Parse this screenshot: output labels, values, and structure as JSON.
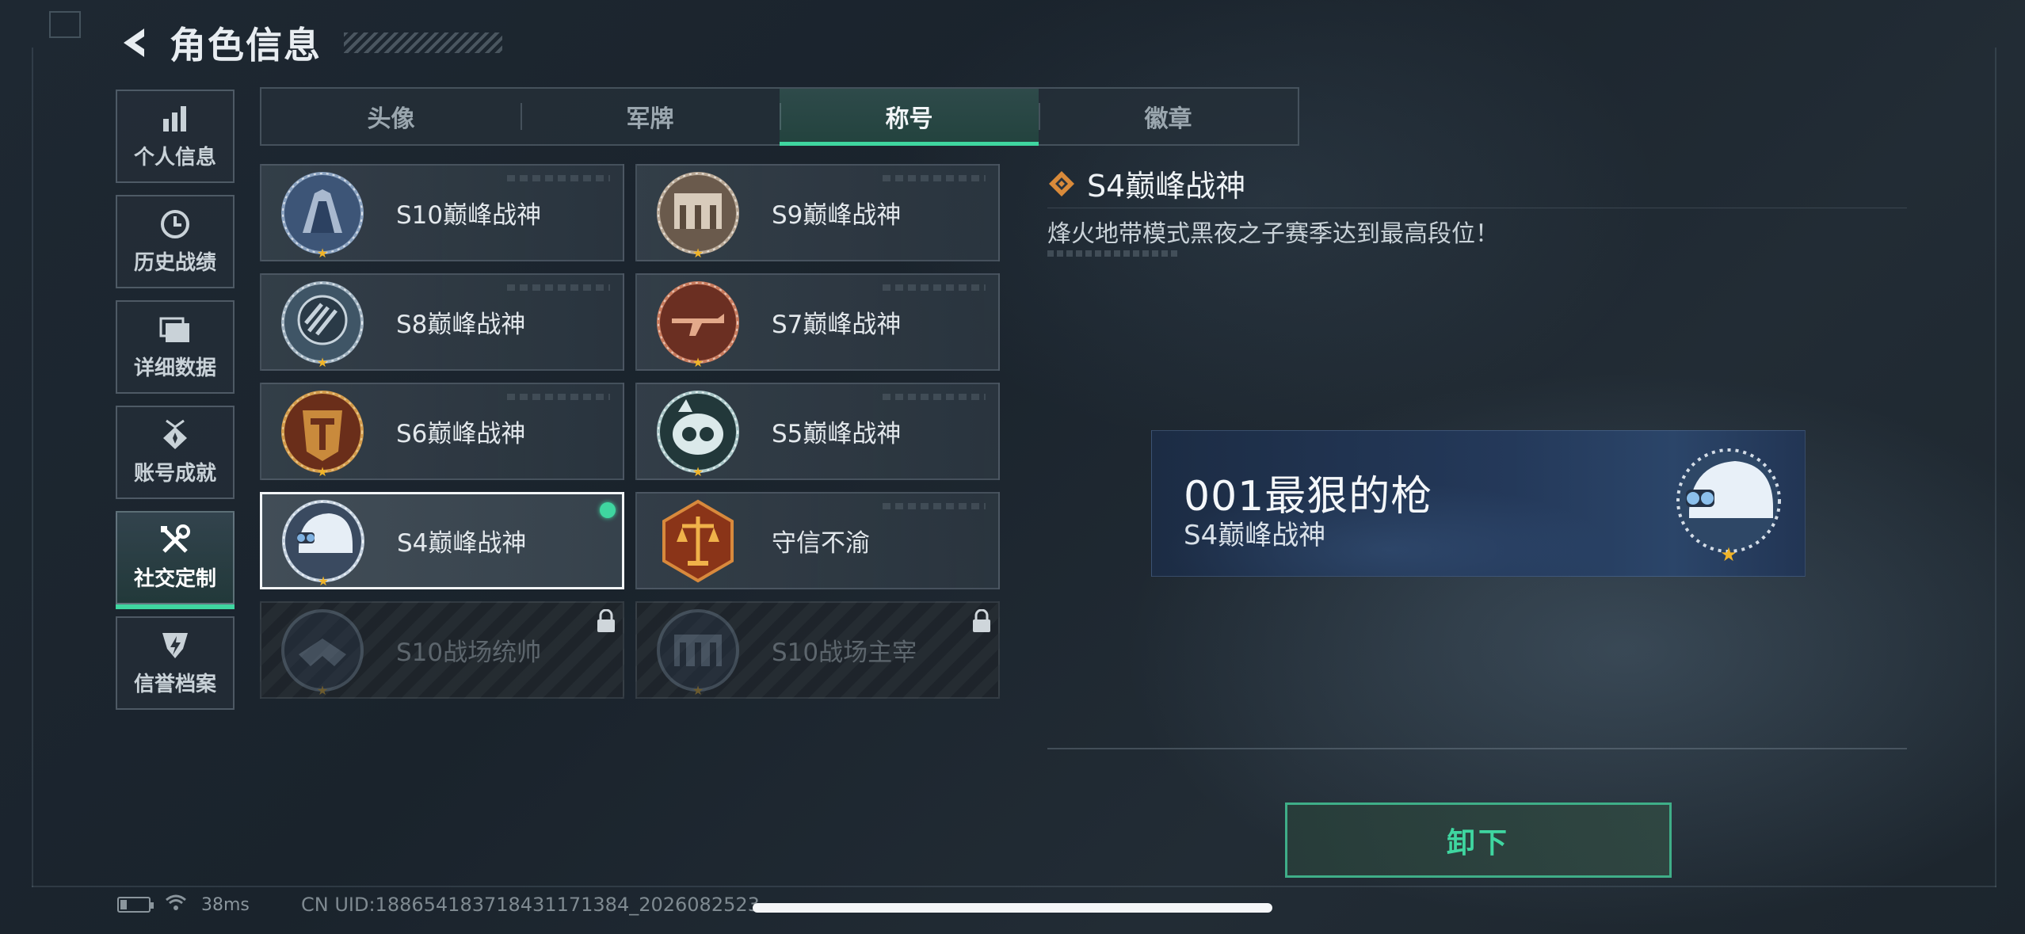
{
  "header": {
    "title": "角色信息",
    "back_icon": "chevron-left-icon"
  },
  "sidebar": {
    "items": [
      {
        "label": "个人信息",
        "icon": "bar-chart-icon",
        "active": false
      },
      {
        "label": "历史战绩",
        "icon": "clock-icon",
        "active": false
      },
      {
        "label": "详细数据",
        "icon": "folder-icon",
        "active": false
      },
      {
        "label": "账号成就",
        "icon": "medal-icon",
        "active": false
      },
      {
        "label": "社交定制",
        "icon": "wrench-screwdriver-icon",
        "active": true
      },
      {
        "label": "信誉档案",
        "icon": "shield-badge-icon",
        "active": false
      }
    ]
  },
  "tabs": [
    {
      "label": "头像",
      "active": false
    },
    {
      "label": "军牌",
      "active": false
    },
    {
      "label": "称号",
      "active": true
    },
    {
      "label": "徽章",
      "active": false
    }
  ],
  "titles": [
    {
      "name": "S10巅峰战神",
      "state": "normal",
      "emblem": "s10-emblem"
    },
    {
      "name": "S9巅峰战神",
      "state": "normal",
      "emblem": "s9-emblem"
    },
    {
      "name": "S8巅峰战神",
      "state": "normal",
      "emblem": "s8-emblem"
    },
    {
      "name": "S7巅峰战神",
      "state": "normal",
      "emblem": "s7-emblem"
    },
    {
      "name": "S6巅峰战神",
      "state": "normal",
      "emblem": "s6-emblem"
    },
    {
      "name": "S5巅峰战神",
      "state": "normal",
      "emblem": "s5-emblem"
    },
    {
      "name": "S4巅峰战神",
      "state": "selected",
      "emblem": "s4-emblem"
    },
    {
      "name": "守信不渝",
      "state": "normal",
      "emblem": "scale-emblem"
    },
    {
      "name": "S10战场统帅",
      "state": "locked",
      "emblem": "s10-commander-emblem"
    },
    {
      "name": "S10战场主宰",
      "state": "locked",
      "emblem": "s10-dominator-emblem"
    }
  ],
  "detail": {
    "title": "S4巅峰战神",
    "description": "烽火地带模式黑夜之子赛季达到最高段位！"
  },
  "nameplate": {
    "player_name": "001最狠的枪",
    "title": "S4巅峰战神"
  },
  "actions": {
    "unequip_label": "卸下"
  },
  "status_bar": {
    "ping": "38ms",
    "uid": "CN UID:18865418371843117138​4_2026082523"
  },
  "colors": {
    "accent": "#3fd6a0",
    "background": "#1e2832",
    "star": "#f0b429"
  }
}
